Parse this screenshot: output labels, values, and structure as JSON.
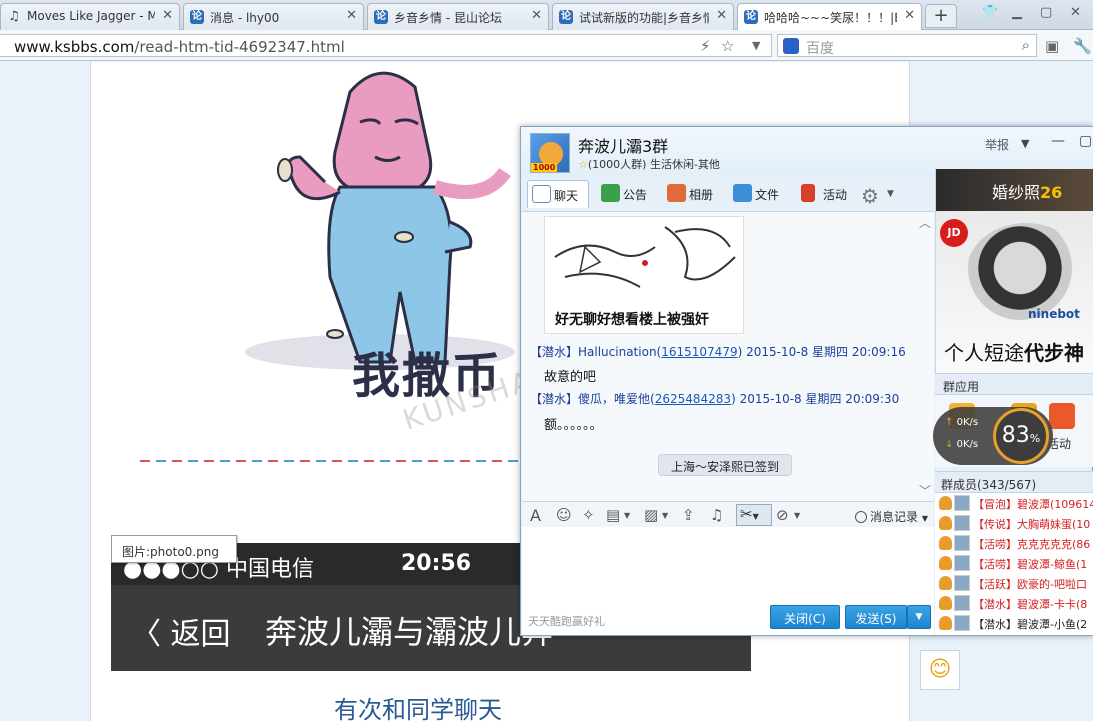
{
  "browser": {
    "tabs": [
      {
        "title": "Moves Like Jagger - M",
        "icon": "headphones-icon",
        "glyph": "♫",
        "active": false
      },
      {
        "title": "消息 - lhy00",
        "icon": "forum-favicon",
        "glyph": "论",
        "active": false
      },
      {
        "title": "乡音乡情 - 昆山论坛",
        "icon": "forum-favicon",
        "glyph": "论",
        "active": false
      },
      {
        "title": "试试新版的功能|乡音乡情",
        "icon": "forum-favicon",
        "glyph": "论",
        "active": false
      },
      {
        "title": "哈哈哈~~~笑尿！！！|E",
        "icon": "forum-favicon",
        "glyph": "论",
        "active": true
      }
    ],
    "new_tab_glyph": "+",
    "url_host": "www.ksbbs.com",
    "url_path": "/read-htm-tid-4692347.html",
    "search_placeholder": "百度"
  },
  "page": {
    "meme_caption": "我撒币",
    "watermark": "KUNSHAN",
    "image_tooltip": "图片:photo0.png",
    "phone_carrier": "●●●○○ 中国电信",
    "phone_time": "20:56",
    "phone_back": "〈 返回",
    "phone_title": "奔波儿灞与灞波儿奔",
    "below_text": "有次和同学聊天"
  },
  "qq": {
    "group_name": "奔波儿灞3群",
    "group_badge": "1000",
    "group_sub": "(1000人群) 生活休闲-其他",
    "report": "举报",
    "tabs": [
      {
        "label": "聊天",
        "icon": "chat-icon",
        "color": "#5b8fc9"
      },
      {
        "label": "公告",
        "icon": "announcement-icon",
        "color": "#3aa04a"
      },
      {
        "label": "相册",
        "icon": "album-icon",
        "color": "#e06a3a"
      },
      {
        "label": "文件",
        "icon": "folder-icon",
        "color": "#3a8fd6"
      },
      {
        "label": "活动",
        "icon": "flag-icon",
        "color": "#d8402a"
      }
    ],
    "chat_image_caption": "好无聊好想看楼上被强奸",
    "messages": [
      {
        "role": "【潜水】",
        "name": "Hallucination",
        "uid": "1615107479",
        "time": "2015-10-8 星期四 20:09:16",
        "text": "故意的吧"
      },
      {
        "role": "【潜水】",
        "name": "傻瓜，唯爱他",
        "uid": "2625484283",
        "time": "2015-10-8 星期四 20:09:30",
        "text": "额。。。。。。"
      }
    ],
    "system_notice": "上海～安泽熙已签到",
    "history_label": "消息记录",
    "promo": "天天酷跑赢好礼",
    "close_button": "关闭(C)",
    "send_button": "发送(S)",
    "ad": {
      "title": "婚纱照",
      "title_num": "26",
      "brand": "ninebot",
      "slogan_plain": "个人短途",
      "slogan_bold": "代步神"
    },
    "apps_label": "群应用",
    "apps_extra": "活动",
    "speed": {
      "up": "0K/s",
      "down": "0K/s",
      "percent": "83",
      "unit": "%"
    },
    "members_label": "群成员(343/567)",
    "members": [
      {
        "text": "【冒泡】碧波潭(109614",
        "color": "red"
      },
      {
        "text": "【传说】大胸萌妹蛋(10",
        "color": "red"
      },
      {
        "text": "【活唠】克克克克克(86",
        "color": "red"
      },
      {
        "text": "【活唠】碧波潭-鲸鱼(1",
        "color": "red"
      },
      {
        "text": "【活跃】欧豪的-吧啦口",
        "color": "red"
      },
      {
        "text": "【潜水】碧波潭-卡卡(8",
        "color": "red"
      },
      {
        "text": "【潜水】碧波潭-小鱼(2",
        "color": "dark"
      }
    ]
  }
}
